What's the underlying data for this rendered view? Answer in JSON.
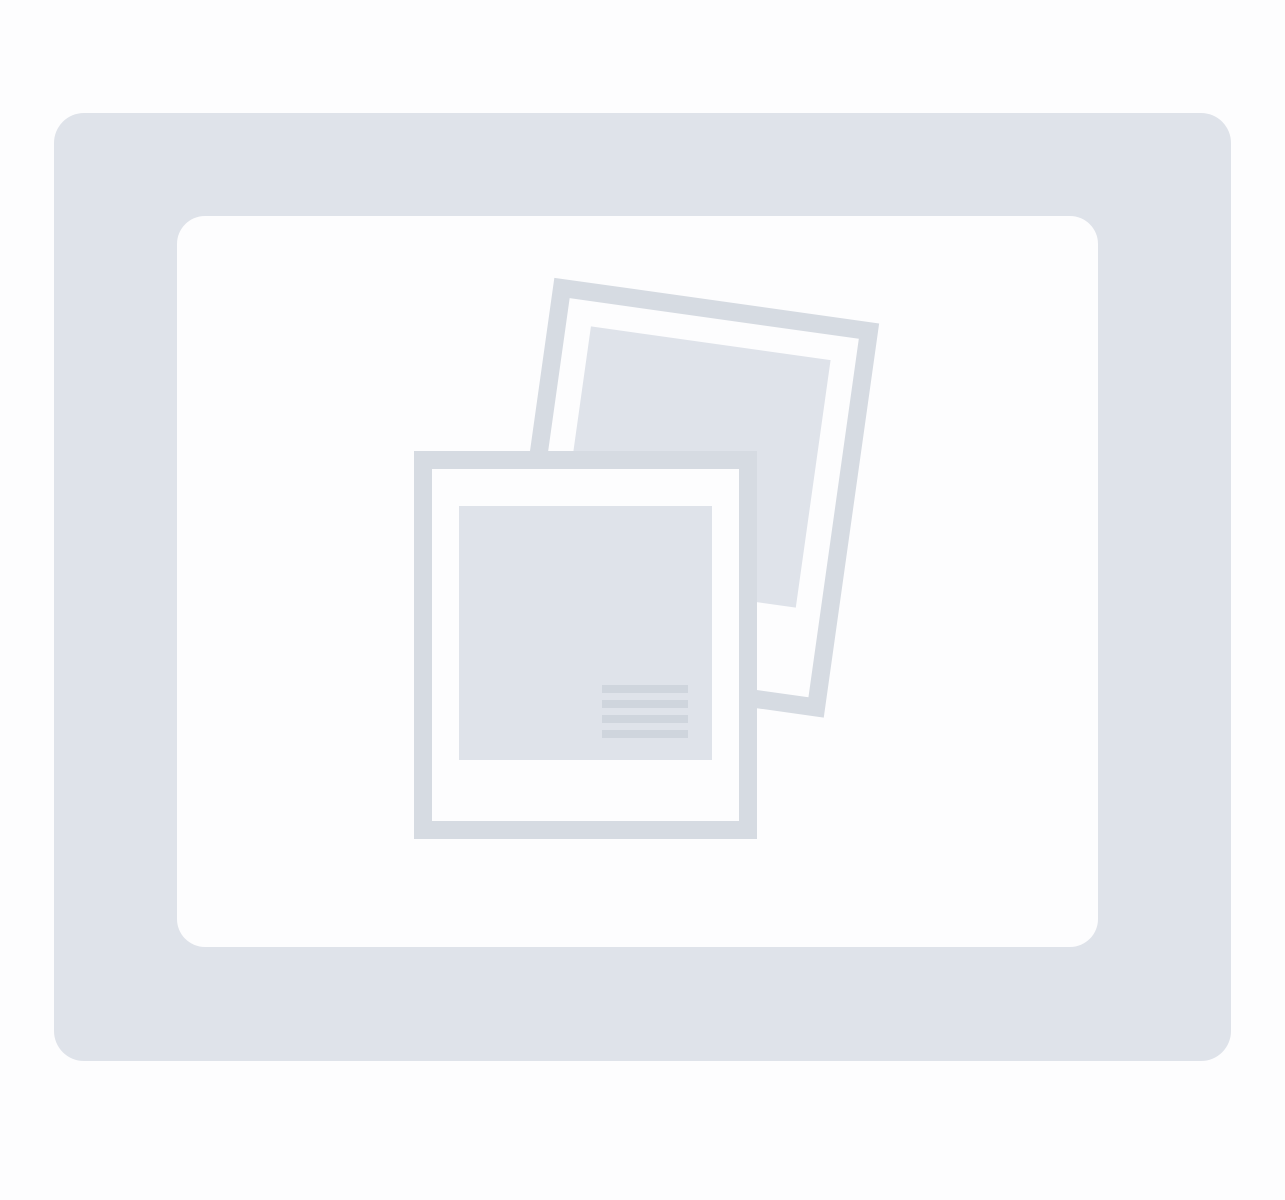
{
  "placeholder": {
    "icon": "image-placeholder-icon",
    "colors": {
      "page_background": "#fdfdfe",
      "frame": "#dfe3ea",
      "panel": "#fdfdfe",
      "icon_stroke": "#d6dbe2",
      "icon_fill": "#dfe3ea",
      "mark": "#cfd5dd"
    }
  }
}
